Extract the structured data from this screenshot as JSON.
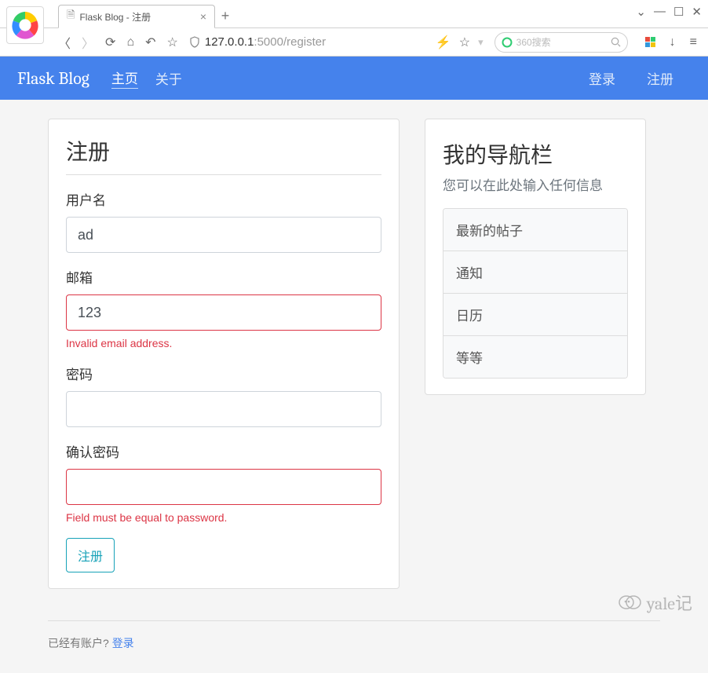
{
  "browser": {
    "tab_title": "Flask Blog - 注册",
    "url_gray_prefix": "127.0.0.1",
    "url_emph": ":5000/register",
    "search_placeholder": "360搜索"
  },
  "nav": {
    "brand": "Flask Blog",
    "home": "主页",
    "about": "关于",
    "login": "登录",
    "register": "注册"
  },
  "form": {
    "title": "注册",
    "username_label": "用户名",
    "username_value": "ad",
    "email_label": "邮箱",
    "email_value": "123",
    "email_error": "Invalid email address.",
    "password_label": "密码",
    "password_value": "",
    "confirm_label": "确认密码",
    "confirm_value": "",
    "confirm_error": "Field must be equal to password.",
    "submit_label": "注册"
  },
  "below": {
    "have_account": "已经有账户?",
    "login_link": "登录"
  },
  "sidebar": {
    "title": "我的导航栏",
    "subtitle": "您可以在此处输入任何信息",
    "items": [
      "最新的帖子",
      "通知",
      "日历",
      "等等"
    ]
  },
  "watermark": "yale记"
}
